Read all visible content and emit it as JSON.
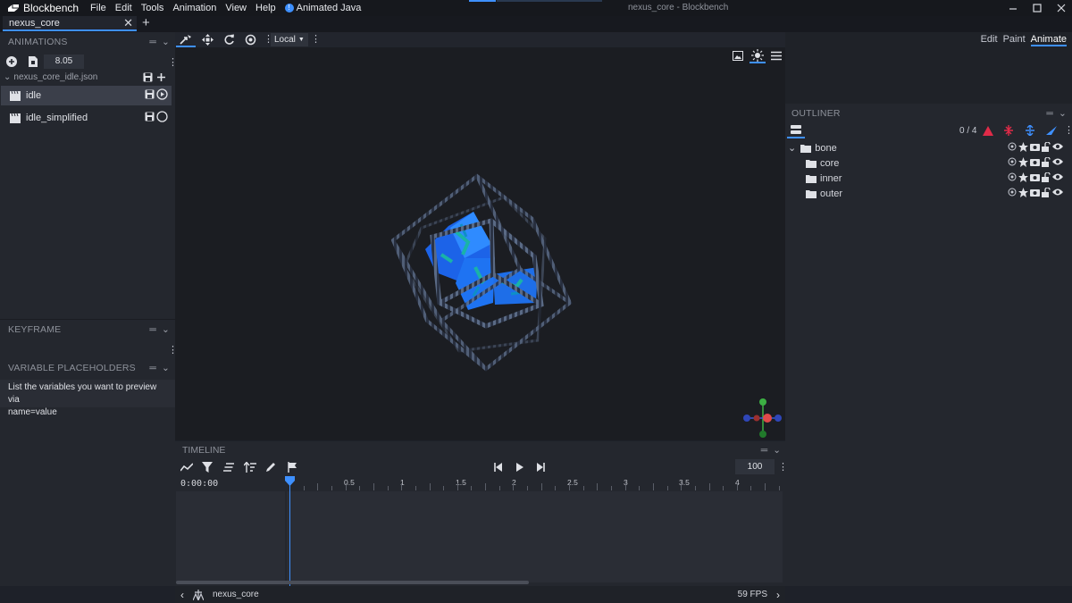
{
  "app": {
    "name": "Blockbench",
    "window_title": "nexus_core - Blockbench",
    "menu": [
      "File",
      "Edit",
      "Tools",
      "Animation",
      "View",
      "Help"
    ],
    "plugin_menu": "Animated Java"
  },
  "tabs": [
    {
      "label": "nexus_core"
    }
  ],
  "left": {
    "animations": {
      "title": "ANIMATIONS",
      "length_value": "8.05",
      "file": "nexus_core_idle.json",
      "items": [
        {
          "label": "idle",
          "selected": true,
          "playing": true
        },
        {
          "label": "idle_simplified",
          "selected": false,
          "playing": false
        }
      ]
    },
    "keyframe": {
      "title": "KEYFRAME"
    },
    "variables": {
      "title": "VARIABLE PLACEHOLDERS",
      "hint_line1": "List the variables you want to preview via",
      "hint_line2": "name=value"
    }
  },
  "toolbar": {
    "space_select": "Local",
    "tools": [
      "move-pivot-icon",
      "move-icon",
      "rotate-icon",
      "pivot-icon"
    ]
  },
  "modes": [
    {
      "label": "Edit",
      "active": false
    },
    {
      "label": "Paint",
      "active": false
    },
    {
      "label": "Animate",
      "active": true
    }
  ],
  "outliner": {
    "title": "OUTLINER",
    "count": "0 / 4",
    "nodes": [
      {
        "name": "bone",
        "depth": 0,
        "expanded": true
      },
      {
        "name": "core",
        "depth": 1
      },
      {
        "name": "inner",
        "depth": 1
      },
      {
        "name": "outer",
        "depth": 1
      }
    ]
  },
  "timeline": {
    "title": "TIMELINE",
    "current_time": "0:00:00",
    "speed": "100",
    "ruler_labels": [
      "0.5",
      "1",
      "1.5",
      "2",
      "2.5",
      "3",
      "3.5",
      "4"
    ],
    "playhead_seconds": 0
  },
  "status": {
    "model_name": "nexus_core",
    "fps": "59 FPS"
  },
  "colors": {
    "accent": "#3e90ff",
    "gizmo_x": "#e04a4a",
    "gizmo_y": "#3cb043",
    "gizmo_z": "#3a5ad8",
    "crystal": "#1f6ff5"
  }
}
